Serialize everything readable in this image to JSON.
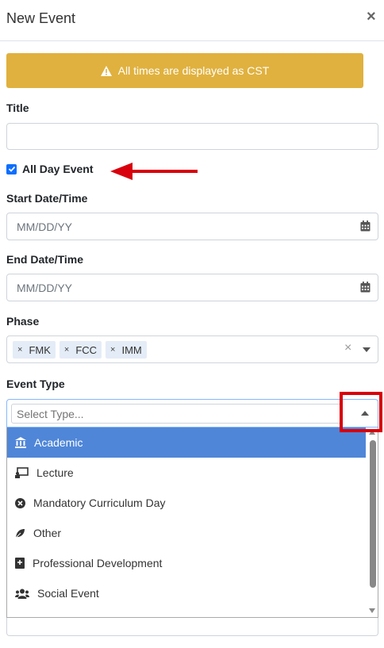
{
  "modal": {
    "title": "New Event",
    "close_label": "×"
  },
  "alert": {
    "text": "All times are displayed as CST"
  },
  "form": {
    "title_label": "Title",
    "title_value": "",
    "all_day_label": "All Day Event",
    "all_day_checked": true,
    "start_label": "Start Date/Time",
    "start_placeholder": "MM/DD/YY",
    "end_label": "End Date/Time",
    "end_placeholder": "MM/DD/YY",
    "phase_label": "Phase",
    "phase_tags": [
      "FMK",
      "FCC",
      "IMM"
    ],
    "event_type_label": "Event Type",
    "event_type_placeholder": "Select Type..."
  },
  "event_type_options": [
    {
      "label": "Academic",
      "icon": "bank-icon",
      "highlighted": true
    },
    {
      "label": "Lecture",
      "icon": "presentation-icon",
      "highlighted": false
    },
    {
      "label": "Mandatory Curriculum Day",
      "icon": "times-circle-icon",
      "highlighted": false
    },
    {
      "label": "Other",
      "icon": "leaf-icon",
      "highlighted": false
    },
    {
      "label": "Professional Development",
      "icon": "book-plus-icon",
      "highlighted": false
    },
    {
      "label": "Social Event",
      "icon": "users-icon",
      "highlighted": false
    }
  ],
  "colors": {
    "alert": "#e0b13e",
    "highlight": "#4f86d8",
    "annotation": "#d8000c",
    "checkbox": "#0d6efd"
  }
}
